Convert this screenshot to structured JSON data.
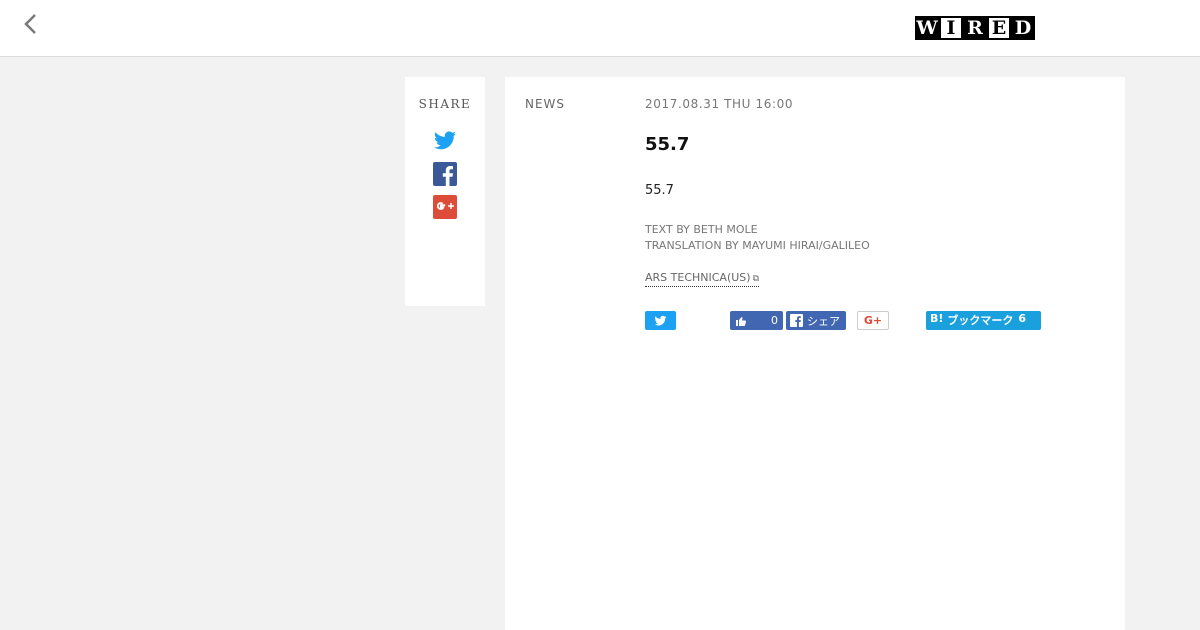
{
  "header": {
    "logo_letters": [
      "W",
      "I",
      "R",
      "E",
      "D"
    ]
  },
  "share_panel": {
    "title": "SHARE",
    "icons": [
      "twitter-icon",
      "facebook-icon",
      "google-plus-icon"
    ]
  },
  "article": {
    "category": "NEWS",
    "date": "2017.08.31 THU 16:00",
    "headline": "55.7",
    "lead": "55.7",
    "text_by": "TEXT BY BETH MOLE",
    "translation_by": "TRANSLATION BY MAYUMI HIRAI/GALILEO",
    "source": "ARS TECHNICA(US)"
  },
  "social_buttons": {
    "like_count": "0",
    "fb_share_label": "シェア",
    "gplus_label": "G+",
    "hatena_label": "ブックマーク",
    "hatena_count": "6"
  },
  "colors": {
    "twitter": "#1da1f2",
    "facebook": "#3b5998",
    "google_plus": "#dd4b39",
    "hatena": "#1aa0dc"
  }
}
